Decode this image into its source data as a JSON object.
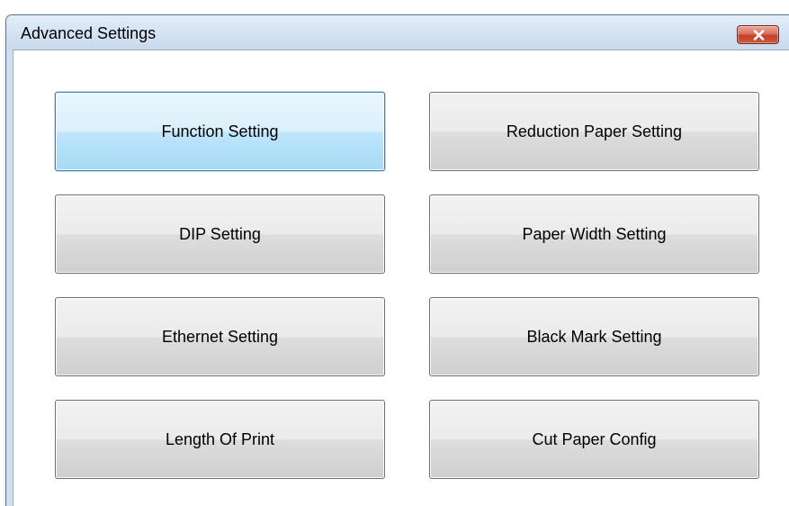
{
  "window": {
    "title": "Advanced Settings"
  },
  "buttons": {
    "function_setting": "Function Setting",
    "reduction_paper_setting": "Reduction Paper Setting",
    "dip_setting": "DIP Setting",
    "paper_width_setting": "Paper Width Setting",
    "ethernet_setting": "Ethernet Setting",
    "black_mark_setting": "Black Mark Setting",
    "length_of_print": "Length Of Print",
    "cut_paper_config": "Cut Paper Config"
  },
  "icons": {
    "close": "close-icon"
  },
  "colors": {
    "titlebar": "#d6e4f3",
    "close_button": "#c2402a",
    "focus_border": "#3c7fb1"
  }
}
